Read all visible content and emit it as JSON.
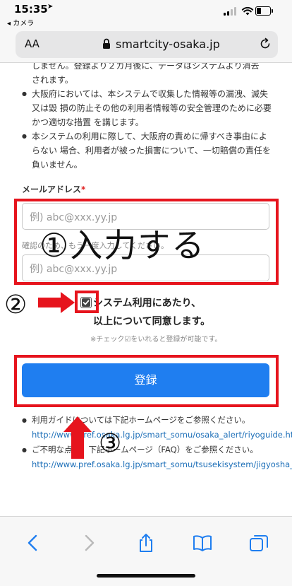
{
  "status": {
    "time": "15:35",
    "back_label": "◂ カメラ"
  },
  "address_bar": {
    "text_size_label": "AA",
    "url": "smartcity-osaka.jp"
  },
  "terms": [
    {
      "text": "しません。登録より２カ月後に、データはシステムより消去",
      "continuation": true
    },
    {
      "text": "されます。",
      "continuation": true
    },
    {
      "text": "大阪府においては、本システムで収集した情報等の漏洩、滅失又は毀 損の防止その他の利用者情報等の安全管理のために必要かつ適切な措置 を講じます。"
    },
    {
      "text": "本システムの利用に際して、大阪府の責めに帰すべき事由によらない 場合、利用者が被った損害について、一切賠償の責任を負いません。"
    }
  ],
  "form": {
    "email_label": "メールアドレス",
    "required_mark": "*",
    "email_placeholder": "例) abc@xxx.yy.jp",
    "confirm_hint": "確認のため、もう一度入力してください。",
    "email_confirm_placeholder": "例) abc@xxx.yy.jp",
    "agree_line1": "システム利用にあたり、",
    "agree_line2": "以上について同意します。",
    "agree_checked": true,
    "agree_note": "※チェック☑をいれると登録が可能です。",
    "register_button": "登録"
  },
  "info": [
    {
      "text": "利用ガイドについては下記ホームページをご参照ください。",
      "link": "http://www.pref.osaka.lg.jp/smart_somu/osaka_alert/riyoguide.html"
    },
    {
      "text": "ご不明な点は、下記ホームページ（FAQ）をご参照ください。",
      "link": "http://www.pref.osaka.lg.jp/smart_somu/tsusekisystem/jigyosha_faq.html"
    }
  ],
  "annotations": {
    "step1": "①入力する",
    "step2": "②",
    "step3": "③",
    "color": "#e6141d"
  },
  "colors": {
    "accent": "#1f7ef0",
    "link": "#1d6fb8",
    "required": "#e02020"
  },
  "toolbar": [
    "back-icon",
    "forward-icon",
    "share-icon",
    "bookmarks-icon",
    "tabs-icon"
  ]
}
